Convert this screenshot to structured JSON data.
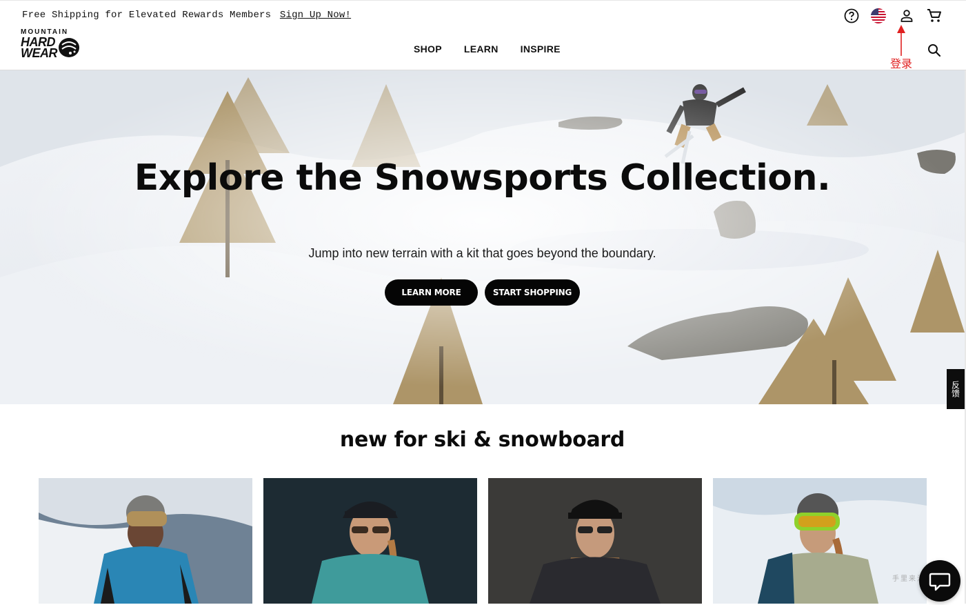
{
  "header": {
    "promo_text": "Free Shipping for Elevated Rewards Members",
    "promo_link": "Sign Up Now!",
    "logo": {
      "line1": "MOUNTAIN",
      "line2": "HARD",
      "line3": "WEAR"
    },
    "nav": [
      "SHOP",
      "LEARN",
      "INSPIRE"
    ],
    "annotation_label": "登录"
  },
  "hero": {
    "title": "Explore the Snowsports Collection.",
    "subtitle": "Jump into new terrain with a kit that goes beyond the boundary.",
    "buttons": {
      "learn_more": "LEARN MORE",
      "start_shopping": "START SHOPPING"
    }
  },
  "feedback_tab": "反馈",
  "section": {
    "title": "new for ski & snowboard"
  },
  "watermark": "手里来活网",
  "colors": {
    "annotation": "#e02020",
    "button": "#050505"
  }
}
